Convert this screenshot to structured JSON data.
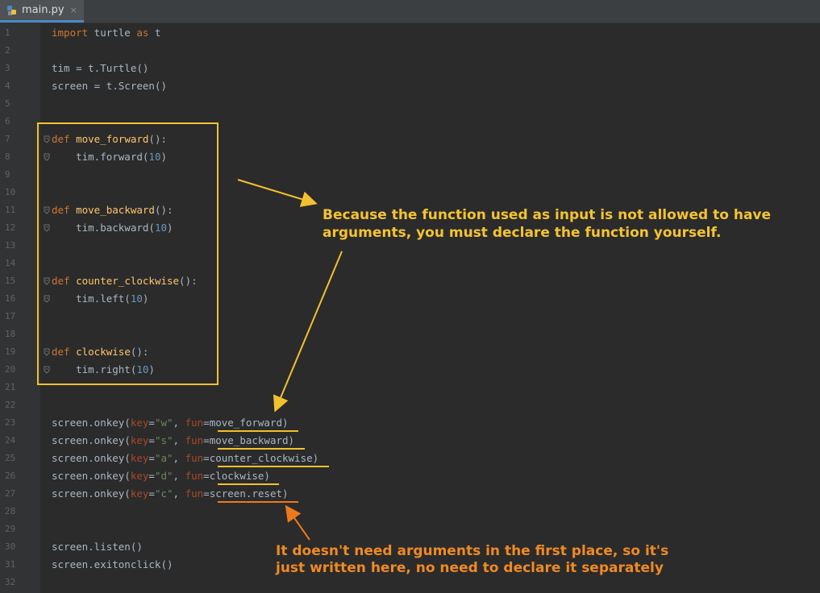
{
  "tab": {
    "filename": "main.py",
    "close": "×",
    "icon": "python-file-icon"
  },
  "lines": [
    {
      "n": "1",
      "tokens": [
        [
          "kw",
          "import"
        ],
        [
          "t",
          " turtle "
        ],
        [
          "kw",
          "as"
        ],
        [
          "t",
          " t"
        ]
      ]
    },
    {
      "n": "2",
      "tokens": []
    },
    {
      "n": "3",
      "tokens": [
        [
          "t",
          "tim = t.Turtle()"
        ]
      ]
    },
    {
      "n": "4",
      "tokens": [
        [
          "t",
          "screen = t.Screen()"
        ]
      ]
    },
    {
      "n": "5",
      "tokens": []
    },
    {
      "n": "6",
      "tokens": []
    },
    {
      "n": "7",
      "tokens": [
        [
          "kw",
          "def "
        ],
        [
          "fn",
          "move_forward"
        ],
        [
          "t",
          "():"
        ]
      ]
    },
    {
      "n": "8",
      "tokens": [
        [
          "t",
          "    tim.forward("
        ],
        [
          "num",
          "10"
        ],
        [
          "t",
          ")"
        ]
      ]
    },
    {
      "n": "9",
      "tokens": []
    },
    {
      "n": "10",
      "tokens": []
    },
    {
      "n": "11",
      "tokens": [
        [
          "kw",
          "def "
        ],
        [
          "fn",
          "move_backward"
        ],
        [
          "t",
          "():"
        ]
      ]
    },
    {
      "n": "12",
      "tokens": [
        [
          "t",
          "    tim.backward("
        ],
        [
          "num",
          "10"
        ],
        [
          "t",
          ")"
        ]
      ]
    },
    {
      "n": "13",
      "tokens": []
    },
    {
      "n": "14",
      "tokens": []
    },
    {
      "n": "15",
      "tokens": [
        [
          "kw",
          "def "
        ],
        [
          "fn",
          "counter_clockwise"
        ],
        [
          "t",
          "():"
        ]
      ]
    },
    {
      "n": "16",
      "tokens": [
        [
          "t",
          "    tim.left("
        ],
        [
          "num",
          "10"
        ],
        [
          "t",
          ")"
        ]
      ]
    },
    {
      "n": "17",
      "tokens": []
    },
    {
      "n": "18",
      "tokens": []
    },
    {
      "n": "19",
      "tokens": [
        [
          "kw",
          "def "
        ],
        [
          "fn",
          "clockwise"
        ],
        [
          "t",
          "():"
        ]
      ]
    },
    {
      "n": "20",
      "tokens": [
        [
          "t",
          "    tim.right("
        ],
        [
          "num",
          "10"
        ],
        [
          "t",
          ")"
        ]
      ]
    },
    {
      "n": "21",
      "tokens": []
    },
    {
      "n": "22",
      "tokens": []
    },
    {
      "n": "23",
      "tokens": [
        [
          "t",
          "screen.onkey("
        ],
        [
          "param",
          "key"
        ],
        [
          "t",
          "="
        ],
        [
          "str",
          "\"w\""
        ],
        [
          "t",
          ", "
        ],
        [
          "param",
          "fun"
        ],
        [
          "t",
          "=move_forward)"
        ]
      ]
    },
    {
      "n": "24",
      "tokens": [
        [
          "t",
          "screen.onkey("
        ],
        [
          "param",
          "key"
        ],
        [
          "t",
          "="
        ],
        [
          "str",
          "\"s\""
        ],
        [
          "t",
          ", "
        ],
        [
          "param",
          "fun"
        ],
        [
          "t",
          "=move_backward)"
        ]
      ]
    },
    {
      "n": "25",
      "tokens": [
        [
          "t",
          "screen.onkey("
        ],
        [
          "param",
          "key"
        ],
        [
          "t",
          "="
        ],
        [
          "str",
          "\"a\""
        ],
        [
          "t",
          ", "
        ],
        [
          "param",
          "fun"
        ],
        [
          "t",
          "=counter_clockwise)"
        ]
      ]
    },
    {
      "n": "26",
      "tokens": [
        [
          "t",
          "screen.onkey("
        ],
        [
          "param",
          "key"
        ],
        [
          "t",
          "="
        ],
        [
          "str",
          "\"d\""
        ],
        [
          "t",
          ", "
        ],
        [
          "param",
          "fun"
        ],
        [
          "t",
          "=clockwise)"
        ]
      ]
    },
    {
      "n": "27",
      "tokens": [
        [
          "t",
          "screen.onkey("
        ],
        [
          "param",
          "key"
        ],
        [
          "t",
          "="
        ],
        [
          "str",
          "\"c\""
        ],
        [
          "t",
          ", "
        ],
        [
          "param",
          "fun"
        ],
        [
          "t",
          "=screen.reset)"
        ]
      ]
    },
    {
      "n": "28",
      "tokens": []
    },
    {
      "n": "29",
      "tokens": []
    },
    {
      "n": "30",
      "tokens": [
        [
          "t",
          "screen.listen()"
        ]
      ]
    },
    {
      "n": "31",
      "tokens": [
        [
          "t",
          "screen.exitonclick()"
        ]
      ]
    },
    {
      "n": "32",
      "tokens": []
    }
  ],
  "annotations": {
    "yellow_note_line1": "Because the function used as input is not allowed to have",
    "yellow_note_line2": "arguments, you must declare the function yourself.",
    "orange_note_line1": "It doesn't need arguments in the first place, so it's",
    "orange_note_line2": "just written here, no need to declare it separately",
    "yellow_color": "#f2c12e",
    "orange_color": "#ec7a1c"
  }
}
